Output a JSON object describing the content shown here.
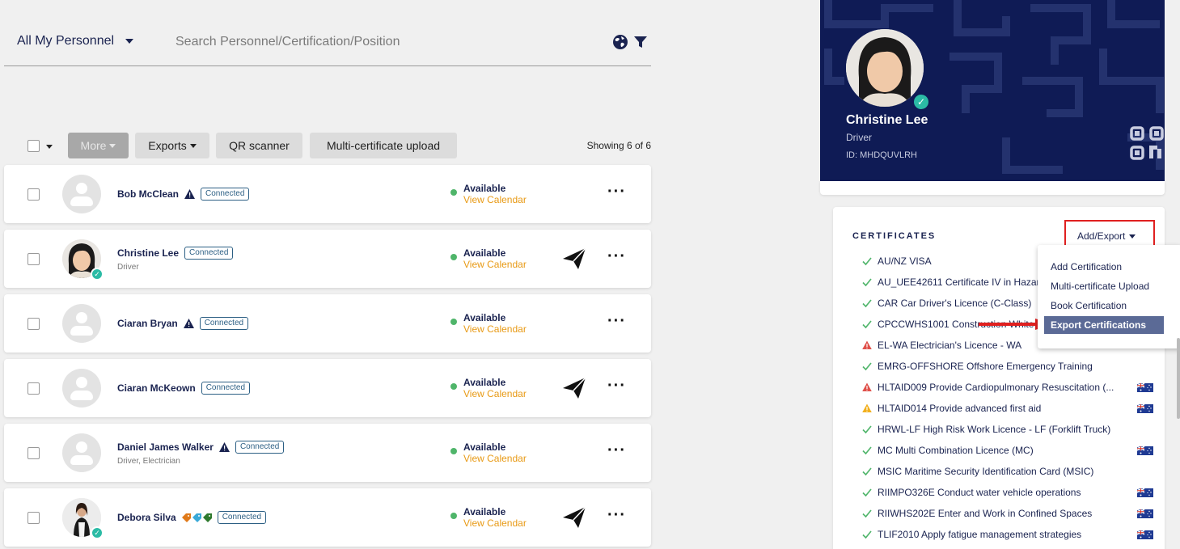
{
  "filter": {
    "label": "All My Personnel"
  },
  "search": {
    "placeholder": "Search Personnel/Certification/Position"
  },
  "toolbar": {
    "more_label": "More",
    "exports_label": "Exports",
    "qr_label": "QR scanner",
    "multi_upload_label": "Multi-certificate upload",
    "showing": "Showing 6 of 6"
  },
  "personnel": [
    {
      "name": "Bob McClean",
      "badge": "Connected",
      "role": "",
      "status": "Available",
      "calendar": "View Calendar"
    },
    {
      "name": "Christine Lee",
      "badge": "Connected",
      "role": "Driver",
      "status": "Available",
      "calendar": "View Calendar"
    },
    {
      "name": "Ciaran Bryan",
      "badge": "Connected",
      "role": "",
      "status": "Available",
      "calendar": "View Calendar"
    },
    {
      "name": "Ciaran McKeown",
      "badge": "Connected",
      "role": "",
      "status": "Available",
      "calendar": "View Calendar"
    },
    {
      "name": "Daniel James Walker",
      "badge": "Connected",
      "role": "Driver, Electrician",
      "status": "Available",
      "calendar": "View Calendar"
    },
    {
      "name": "Debora Silva",
      "badge": "Connected",
      "role": "",
      "status": "Available",
      "calendar": "View Calendar"
    }
  ],
  "profile": {
    "name": "Christine Lee",
    "role": "Driver",
    "id": "ID: MHDQUVLRH"
  },
  "certificates": {
    "title": "CERTIFICATES",
    "add_export_label": "Add/Export",
    "items": [
      {
        "label": "AU/NZ VISA",
        "status": "valid",
        "flag": false
      },
      {
        "label": "AU_UEE42611 Certificate IV in Hazar",
        "status": "valid",
        "flag": false
      },
      {
        "label": "CAR Car Driver's Licence (C-Class)",
        "status": "valid",
        "flag": false
      },
      {
        "label": "CPCCWHS1001 Construction White",
        "status": "valid",
        "flag": false
      },
      {
        "label": "EL-WA Electrician's Licence - WA",
        "status": "error",
        "flag": false
      },
      {
        "label": "EMRG-OFFSHORE Offshore Emergency Training",
        "status": "valid",
        "flag": false
      },
      {
        "label": "HLTAID009 Provide Cardiopulmonary Resuscitation (...",
        "status": "error",
        "flag": true
      },
      {
        "label": "HLTAID014 Provide advanced first aid",
        "status": "warning",
        "flag": true
      },
      {
        "label": "HRWL-LF High Risk Work Licence - LF (Forklift Truck)",
        "status": "valid",
        "flag": false
      },
      {
        "label": "MC Multi Combination Licence (MC)",
        "status": "valid",
        "flag": true
      },
      {
        "label": "MSIC Maritime Security Identification Card (MSIC)",
        "status": "valid",
        "flag": false
      },
      {
        "label": "RIIMPO326E Conduct water vehicle operations",
        "status": "valid",
        "flag": true
      },
      {
        "label": "RIIWHS202E Enter and Work in Confined Spaces",
        "status": "valid",
        "flag": true
      },
      {
        "label": "TLIF2010 Apply fatigue management strategies",
        "status": "valid",
        "flag": true
      }
    ]
  },
  "add_export_menu": {
    "items": [
      "Add Certification",
      "Multi-certificate Upload",
      "Book Certification",
      "Export Certifications"
    ],
    "active": "Export Certifications"
  },
  "colors": {
    "navy": "#1a2350",
    "profile_bg": "#0f1b55",
    "available": "#4fb56a",
    "calendar_link": "#e89a15",
    "valid_check": "#4fb56a",
    "error": "#e0504a",
    "warning": "#f2b01e",
    "highlight_red": "#e02020",
    "menu_active": "#5b6a96"
  }
}
